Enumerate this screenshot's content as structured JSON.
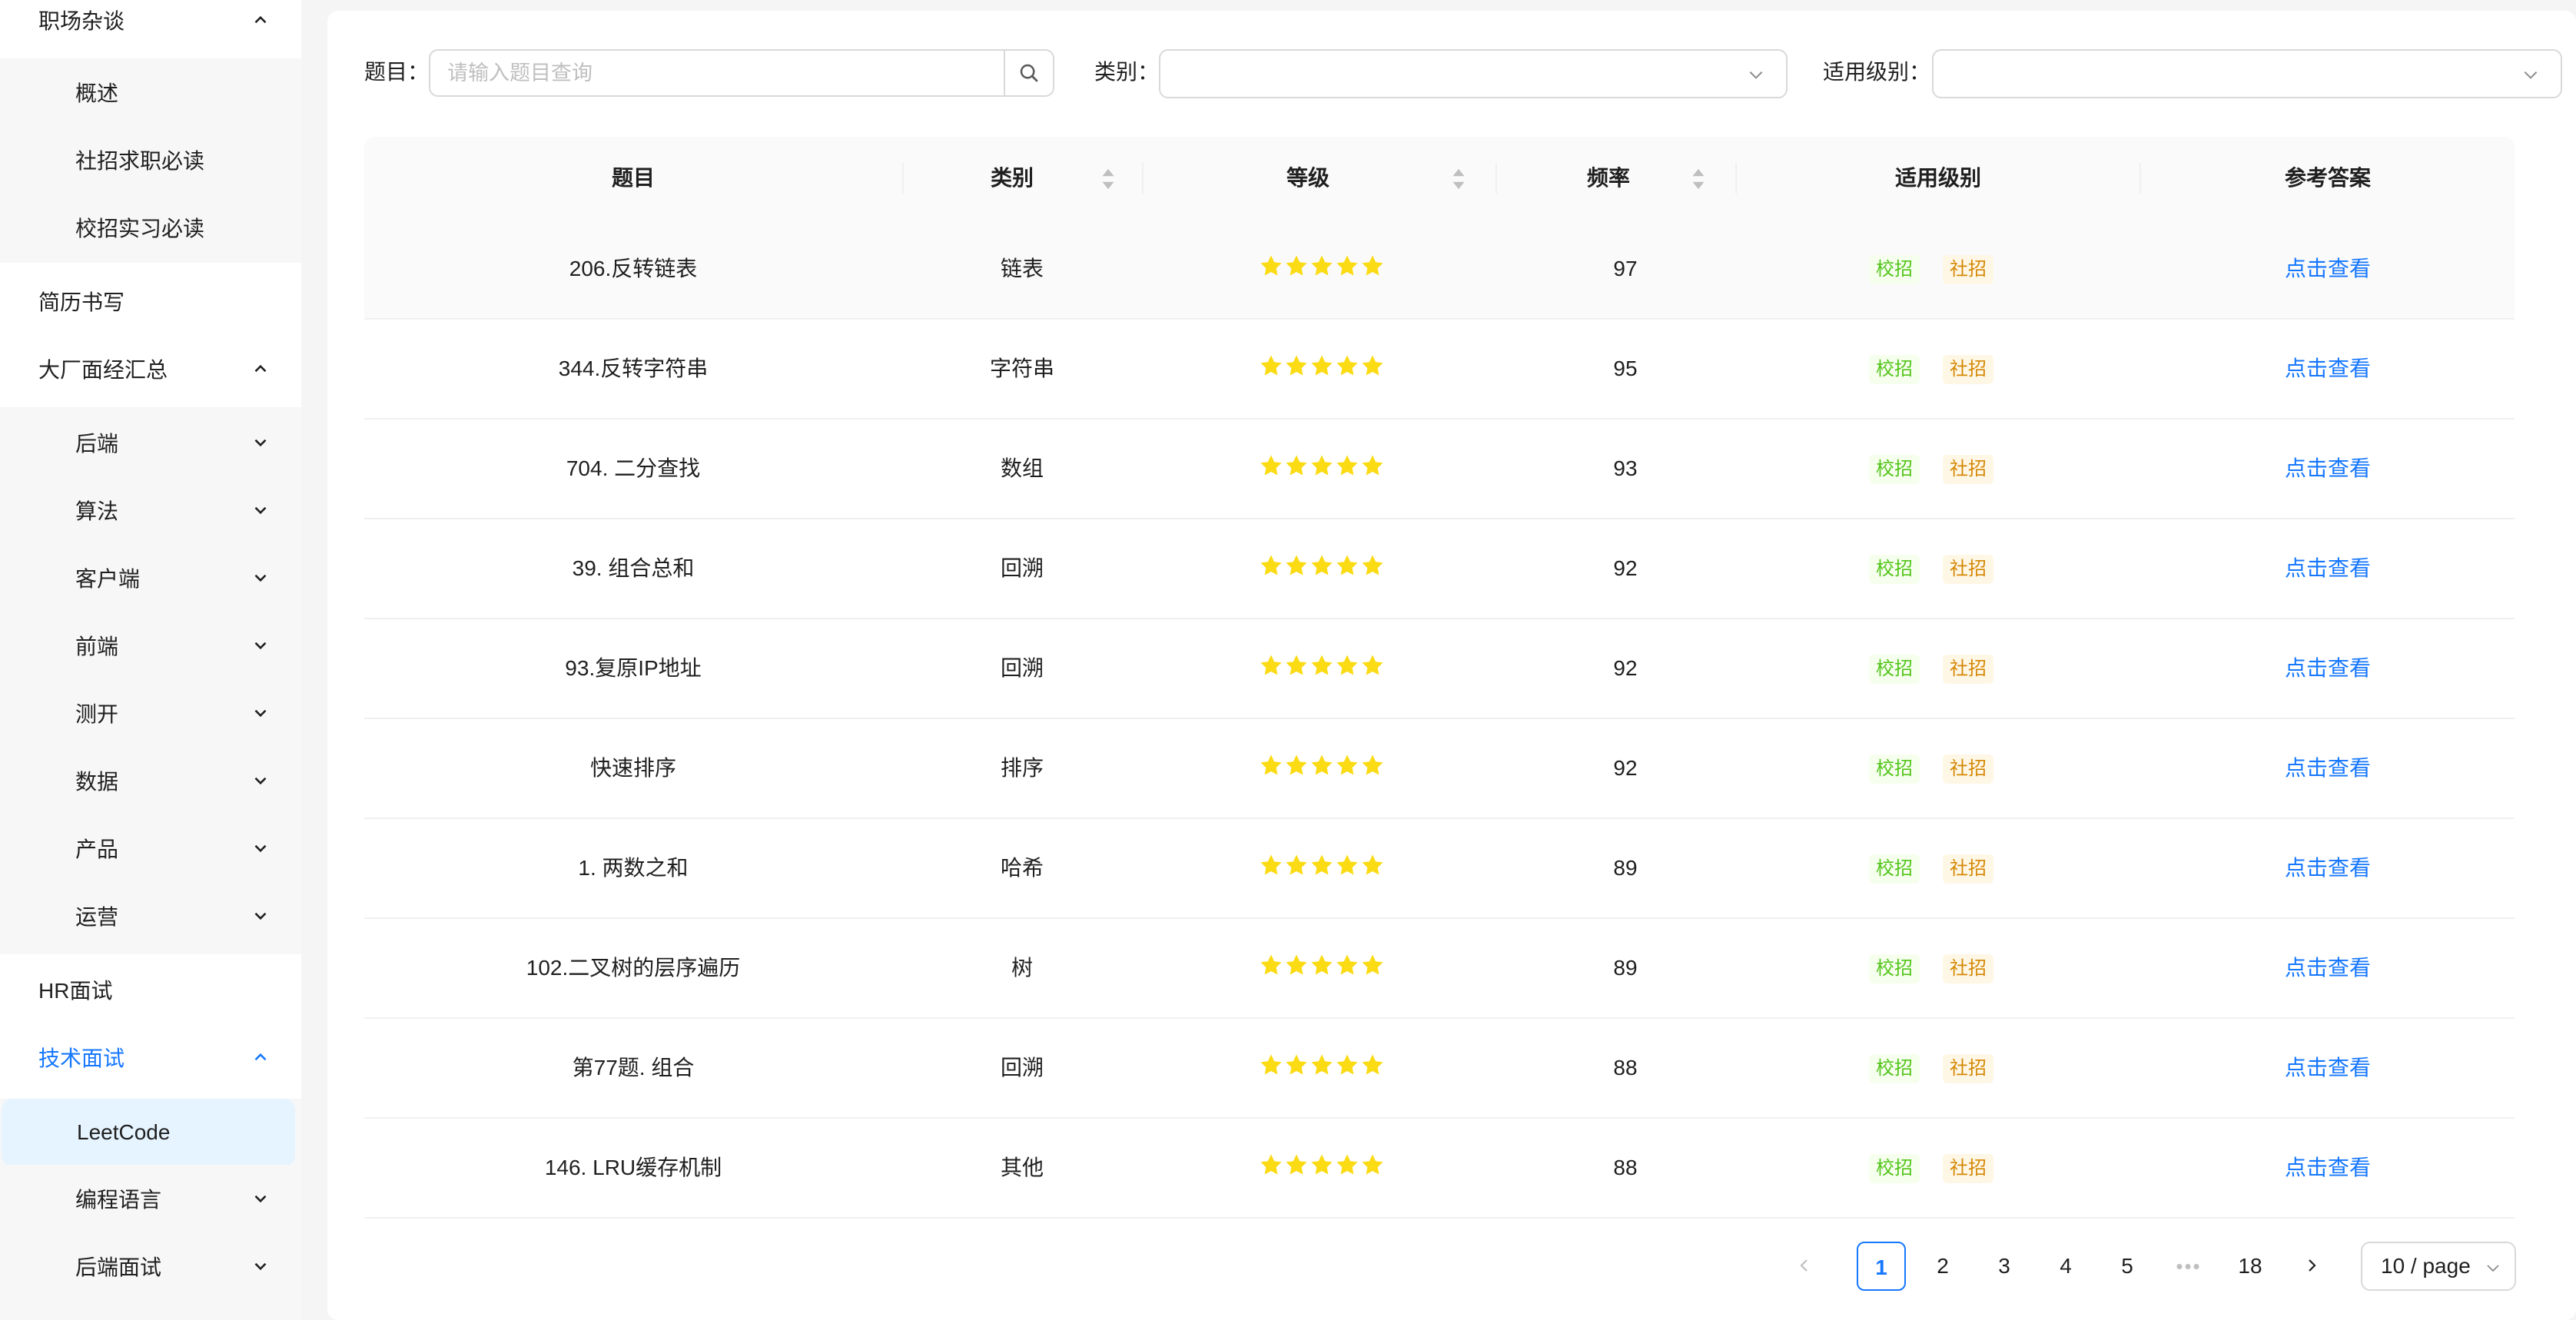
{
  "sidebar": {
    "groups": [
      {
        "label": "职场杂谈",
        "expanded": true,
        "children": [
          "概述",
          "社招求职必读",
          "校招实习必读"
        ]
      },
      {
        "label": "简历书写"
      },
      {
        "label": "大厂面经汇总",
        "expanded": true,
        "children": [
          "后端",
          "算法",
          "客户端",
          "前端",
          "测开",
          "数据",
          "产品",
          "运营"
        ]
      },
      {
        "label": "HR面试"
      },
      {
        "label": "技术面试",
        "expanded": true,
        "active": true,
        "children": [
          "LeetCode",
          "编程语言",
          "后端面试"
        ]
      }
    ],
    "selected": "LeetCode",
    "accent_color": "#1677ff"
  },
  "filters": {
    "title_label": "题目：",
    "title_placeholder": "请输入题目查询",
    "category_label": "类别：",
    "category_value": "",
    "level_label": "适用级别：",
    "level_value": ""
  },
  "table": {
    "columns": [
      "题目",
      "类别",
      "等级",
      "频率",
      "适用级别",
      "参考答案"
    ],
    "rows": [
      {
        "title": "206.反转链表",
        "category": "链表",
        "stars": 5,
        "frequency": "97",
        "levels": [
          "校招",
          "社招"
        ],
        "answer": "点击查看"
      },
      {
        "title": "344.反转字符串",
        "category": "字符串",
        "stars": 5,
        "frequency": "95",
        "levels": [
          "校招",
          "社招"
        ],
        "answer": "点击查看"
      },
      {
        "title": "704. 二分查找",
        "category": "数组",
        "stars": 5,
        "frequency": "93",
        "levels": [
          "校招",
          "社招"
        ],
        "answer": "点击查看"
      },
      {
        "title": "39. 组合总和",
        "category": "回溯",
        "stars": 5,
        "frequency": "92",
        "levels": [
          "校招",
          "社招"
        ],
        "answer": "点击查看"
      },
      {
        "title": "93.复原IP地址",
        "category": "回溯",
        "stars": 5,
        "frequency": "92",
        "levels": [
          "校招",
          "社招"
        ],
        "answer": "点击查看"
      },
      {
        "title": "快速排序",
        "category": "排序",
        "stars": 5,
        "frequency": "92",
        "levels": [
          "校招",
          "社招"
        ],
        "answer": "点击查看"
      },
      {
        "title": "1. 两数之和",
        "category": "哈希",
        "stars": 5,
        "frequency": "89",
        "levels": [
          "校招",
          "社招"
        ],
        "answer": "点击查看"
      },
      {
        "title": "102.二叉树的层序遍历",
        "category": "树",
        "stars": 5,
        "frequency": "89",
        "levels": [
          "校招",
          "社招"
        ],
        "answer": "点击查看"
      },
      {
        "title": "第77题. 组合",
        "category": "回溯",
        "stars": 5,
        "frequency": "88",
        "levels": [
          "校招",
          "社招"
        ],
        "answer": "点击查看"
      },
      {
        "title": "146. LRU缓存机制",
        "category": "其他",
        "stars": 5,
        "frequency": "88",
        "levels": [
          "校招",
          "社招"
        ],
        "answer": "点击查看"
      }
    ],
    "star_color": "#fadb14"
  },
  "pagination": {
    "pages": [
      "1",
      "2",
      "3",
      "4",
      "5"
    ],
    "ellipsis": "•••",
    "last_page": "18",
    "current": "1",
    "page_size": "10 / page"
  }
}
